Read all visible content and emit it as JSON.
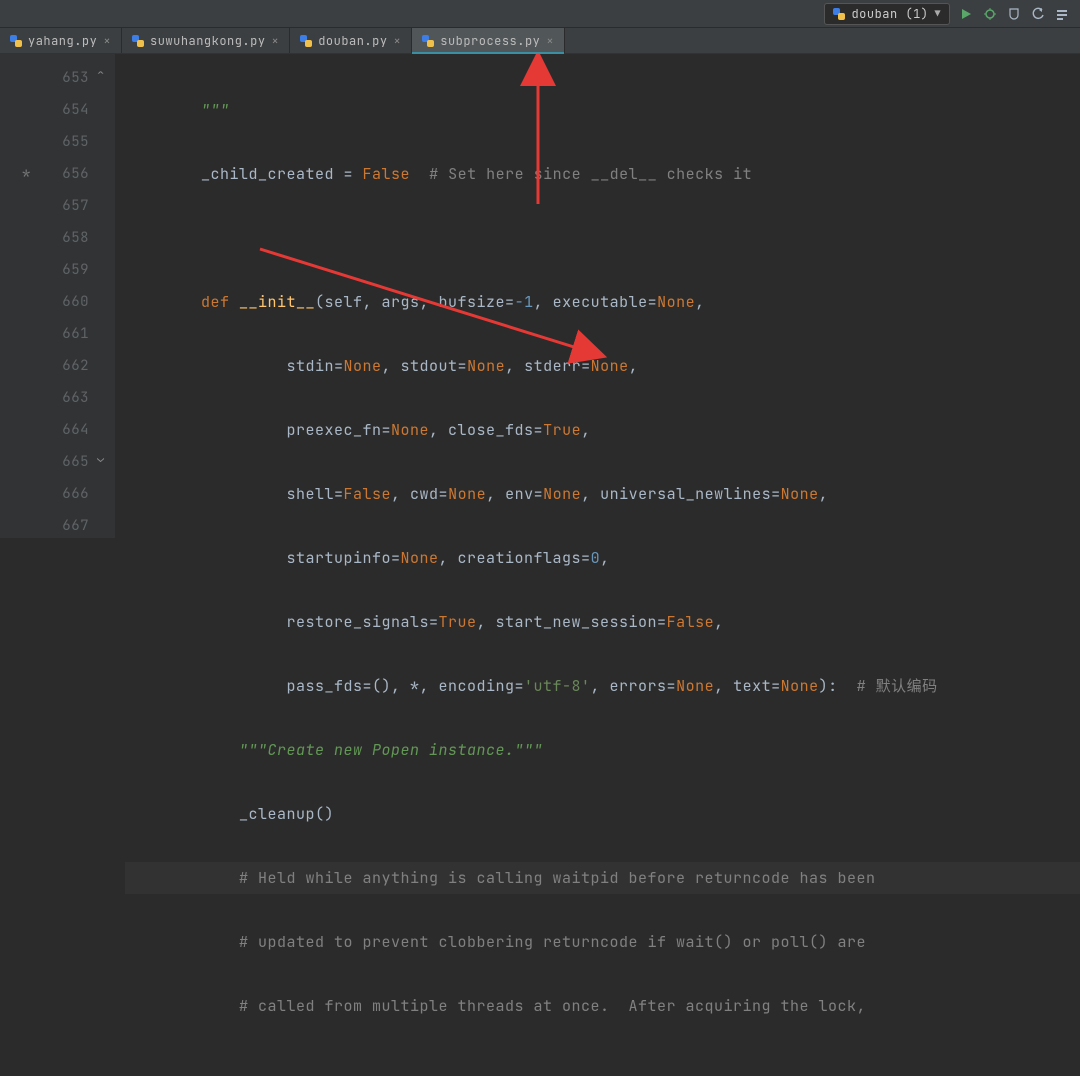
{
  "toolbar": {
    "run_config_label": "douban (1)",
    "icons": [
      "run",
      "debug",
      "coverage",
      "profile",
      "stop"
    ]
  },
  "tabs": [
    {
      "label": "yahang.py",
      "active": false
    },
    {
      "label": "suwuhangkong.py",
      "active": false
    },
    {
      "label": "douban.py",
      "active": false
    },
    {
      "label": "subprocess.py",
      "active": true
    }
  ],
  "gutter": {
    "start": 653,
    "end": 667,
    "breakpoint_at": 656
  },
  "code": {
    "l653": "\"\"\"",
    "l654_a": "_child_created",
    "l654_b": " = ",
    "l654_c": "False",
    "l654_d": "  # Set here since __del__ checks it",
    "l655": "",
    "l656_a": "def ",
    "l656_b": "__init__",
    "l656_c": "(self, args, bufsize=",
    "l656_d": "-1",
    "l656_e": ", executable=",
    "l656_f": "None",
    "l656_g": ",",
    "l657_a": "stdin=",
    "l657_b": "None",
    "l657_c": ", stdout=",
    "l657_d": "None",
    "l657_e": ", stderr=",
    "l657_f": "None",
    "l657_g": ",",
    "l658_a": "preexec_fn=",
    "l658_b": "None",
    "l658_c": ", close_fds=",
    "l658_d": "True",
    "l658_e": ",",
    "l659_a": "shell=",
    "l659_b": "False",
    "l659_c": ", cwd=",
    "l659_d": "None",
    "l659_e": ", env=",
    "l659_f": "None",
    "l659_g": ", universal_newlines=",
    "l659_h": "None",
    "l659_i": ",",
    "l660_a": "startupinfo=",
    "l660_b": "None",
    "l660_c": ", creationflags=",
    "l660_d": "0",
    "l660_e": ",",
    "l661_a": "restore_signals=",
    "l661_b": "True",
    "l661_c": ", start_new_session=",
    "l661_d": "False",
    "l661_e": ",",
    "l662_a": "pass_fds=(), *, encoding=",
    "l662_b": "'utf-8'",
    "l662_c": ", errors=",
    "l662_d": "None",
    "l662_e": ", text=",
    "l662_f": "None",
    "l662_g": "):  ",
    "l662_h": "# 默认编码",
    "l663": "\"\"\"Create new Popen instance.\"\"\"",
    "l664": "_cleanup()",
    "l665": "# Held while anything is calling waitpid before returncode has been",
    "l666": "# updated to prevent clobbering returncode if wait() or poll() are",
    "l667": "# called from multiple threads at once.  After acquiring the lock,"
  }
}
